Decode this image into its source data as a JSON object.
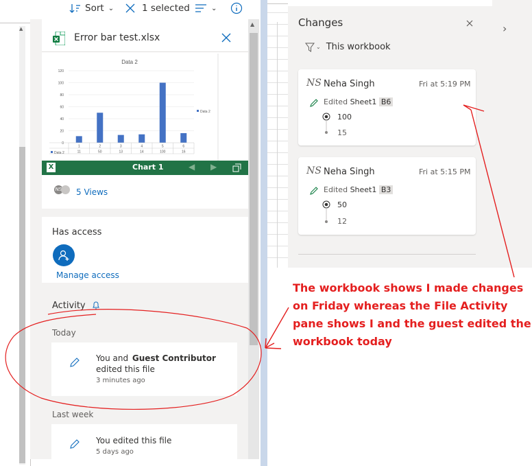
{
  "toolbar": {
    "sort_label": "Sort",
    "selected_label": "1 selected"
  },
  "details": {
    "file_name": "Error bar test.xlsx",
    "chart_preview": {
      "chart_title": "Data 2",
      "legend_label": "Data 2",
      "footer_label": "Chart 1",
      "table_row_label": "Data 2",
      "y_ticks": [
        "120",
        "100",
        "80",
        "60",
        "40",
        "20",
        "0"
      ]
    },
    "views_label": "5 Views",
    "has_access_title": "Has access",
    "manage_access_label": "Manage access",
    "activity_title": "Activity",
    "today_label": "Today",
    "activity_today": {
      "you_and": "You and",
      "guest": "Guest Contributor",
      "edited": "edited this file",
      "time": "3 minutes ago"
    },
    "last_week_label": "Last week",
    "activity_last_week": {
      "text": "You edited this file",
      "time": "5 days ago"
    }
  },
  "chart_data": {
    "type": "bar",
    "title": "Data 2",
    "categories": [
      "1",
      "2",
      "3",
      "4",
      "5",
      "6"
    ],
    "series": [
      {
        "name": "Data 2",
        "values": [
          11,
          50,
          13,
          14,
          100,
          16
        ]
      }
    ],
    "ylim": [
      0,
      120
    ],
    "color": "#4472c4"
  },
  "changes": {
    "title": "Changes",
    "filter_label": "This workbook",
    "entries": [
      {
        "initials": "NS",
        "user": "Neha Singh",
        "time": "Fri at 5:19 PM",
        "edited": "Edited",
        "sheet": "Sheet1",
        "cell": "B6",
        "new_value": "100",
        "old_value": "15"
      },
      {
        "initials": "NS",
        "user": "Neha Singh",
        "time": "Fri at 5:15 PM",
        "edited": "Edited",
        "sheet": "Sheet1",
        "cell": "B3",
        "new_value": "50",
        "old_value": "12"
      }
    ]
  },
  "annotation": {
    "lines": [
      "The workbook shows I made changes",
      "on Friday whereas the File Activity",
      "pane shows I and the guest edited the",
      "workbook today"
    ],
    "color": "#e41f1f"
  }
}
